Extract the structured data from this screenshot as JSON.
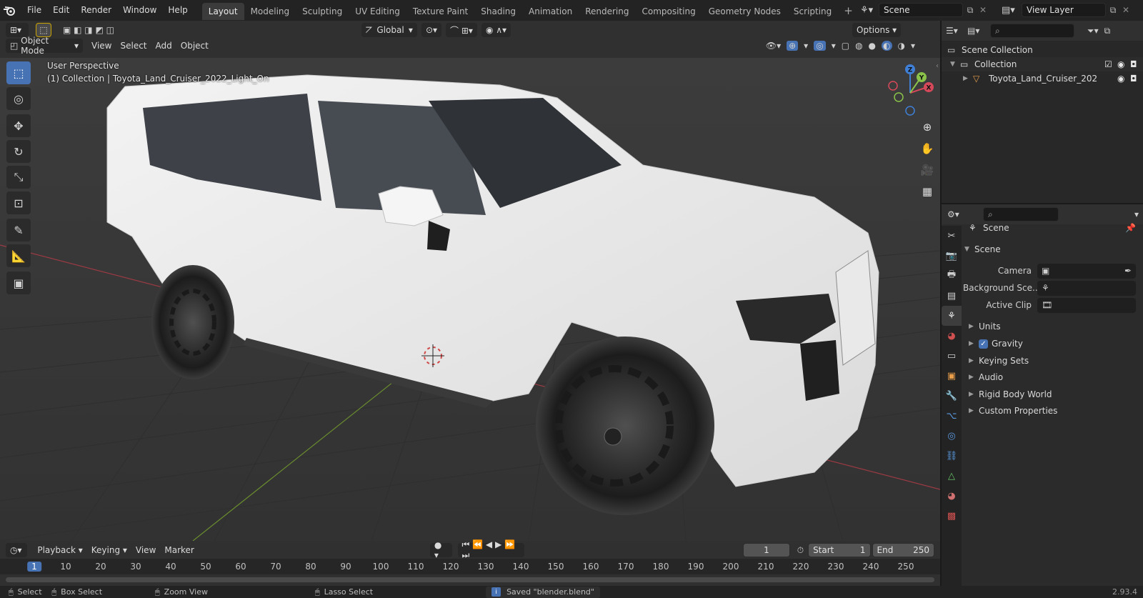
{
  "menu": {
    "items": [
      "File",
      "Edit",
      "Render",
      "Window",
      "Help"
    ]
  },
  "workspaces": {
    "tabs": [
      "Layout",
      "Modeling",
      "Sculpting",
      "UV Editing",
      "Texture Paint",
      "Shading",
      "Animation",
      "Rendering",
      "Compositing",
      "Geometry Nodes",
      "Scripting"
    ],
    "add": "+"
  },
  "scene_selector": {
    "value": "Scene"
  },
  "view_layer": {
    "value": "View Layer"
  },
  "viewport_header": {
    "transform_orientation": "Global",
    "options": "Options",
    "mode": "Object Mode",
    "view": "View",
    "select": "Select",
    "add": "Add",
    "object": "Object"
  },
  "viewport": {
    "perspective": "User Perspective",
    "collection_info": "(1) Collection | Toyota_Land_Cruiser_2022_Light_On",
    "gizmo": {
      "x": "X",
      "y": "Y",
      "z": "Z"
    },
    "colors": {
      "x_axis": "#d6495a",
      "y_axis": "#8bc24a",
      "z_axis": "#3f7fd6",
      "car_body": "#eeeeee",
      "tire": "#262626"
    }
  },
  "timeline": {
    "playback": "Playback",
    "keying": "Keying",
    "view": "View",
    "marker": "Marker",
    "current_frame": "1",
    "start_label": "Start",
    "start_value": "1",
    "end_label": "End",
    "end_value": "250",
    "ticks": [
      "1",
      "10",
      "20",
      "30",
      "40",
      "50",
      "60",
      "70",
      "80",
      "90",
      "100",
      "110",
      "120",
      "130",
      "140",
      "150",
      "160",
      "170",
      "180",
      "190",
      "200",
      "210",
      "220",
      "230",
      "240",
      "250"
    ]
  },
  "statusbar": {
    "select": "Select",
    "box_select": "Box Select",
    "zoom_view": "Zoom View",
    "lasso_select": "Lasso Select",
    "message": "Saved \"blender.blend\"",
    "version": "2.93.4"
  },
  "outliner": {
    "scene_collection": "Scene Collection",
    "collection": "Collection",
    "object": "Toyota_Land_Cruiser_202"
  },
  "properties": {
    "header_title": "Scene",
    "panel_title": "Scene",
    "camera_label": "Camera",
    "background_scene_label": "Background Sce...",
    "active_clip_label": "Active Clip",
    "sections": [
      "Units",
      "Gravity",
      "Keying Sets",
      "Audio",
      "Rigid Body World",
      "Custom Properties"
    ],
    "gravity_checked": true
  }
}
